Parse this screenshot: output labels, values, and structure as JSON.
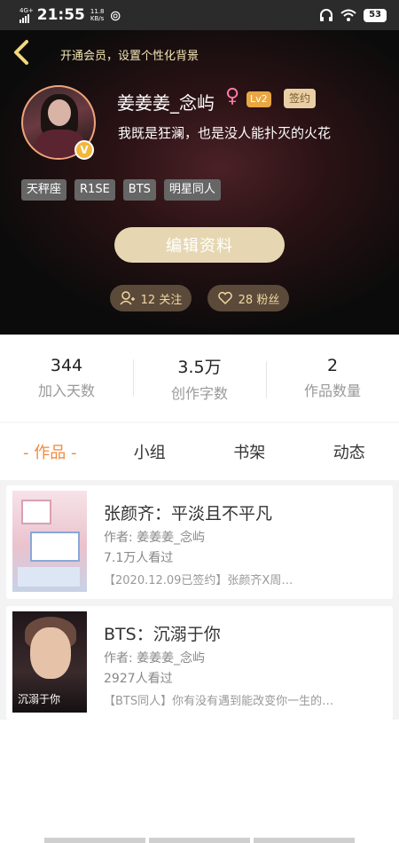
{
  "status": {
    "signal": "4G+",
    "time": "21:55",
    "speed_value": "11.8",
    "speed_unit": "KB/s",
    "battery": "53"
  },
  "header": {
    "vip_link": "开通会员，设置个性化背景",
    "username": "姜姜姜_念屿",
    "gender_symbol": "♀",
    "level": "Lv2",
    "sign_badge": "签约",
    "bio": "我既是狂澜，也是没人能扑灭的火花",
    "v_badge": "V",
    "tags": [
      "天秤座",
      "R1SE",
      "BTS",
      "明星同人"
    ],
    "edit_button": "编辑资料",
    "follow_label": "12 关注",
    "fans_label": "28 粉丝"
  },
  "stats": [
    {
      "value": "344",
      "label": "加入天数"
    },
    {
      "value": "3.5万",
      "label": "创作字数"
    },
    {
      "value": "2",
      "label": "作品数量"
    }
  ],
  "tabs": [
    "- 作品 -",
    "小组",
    "书架",
    "动态"
  ],
  "works": [
    {
      "title": "张颜齐：平淡且不平凡",
      "author": "作者: 姜姜姜_念屿",
      "views": "7.1万人看过",
      "desc": "【2020.12.09已签约】张颜齐X周…"
    },
    {
      "title": "BTS：沉溺于你",
      "author": "作者: 姜姜姜_念屿",
      "views": "2927人看过",
      "desc": "【BTS同人】你有没有遇到能改变你一生的…",
      "cover_text": "沉溺于你"
    }
  ],
  "colors": {
    "accent": "#f08a3a",
    "edit_button": "#e6d7b2",
    "level_badge": "#e9a743"
  }
}
